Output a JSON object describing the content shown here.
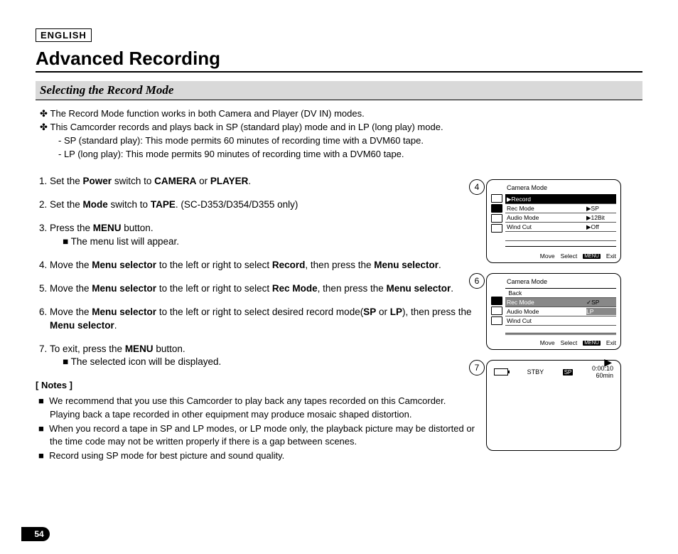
{
  "lang": "ENGLISH",
  "title": "Advanced Recording",
  "section": "Selecting the Record Mode",
  "bullet": "✤",
  "intro": {
    "l1": "The Record Mode function works in both Camera and Player (DV IN) modes.",
    "l2": "This Camcorder records and plays back in SP (standard play) mode and in LP (long play) mode.",
    "l3": "- SP (standard play): This mode permits 60 minutes of recording time with a DVM60 tape.",
    "l4": "- LP (long play): This mode permits 90 minutes of recording time with a DVM60 tape."
  },
  "steps": {
    "s1a": "Set the ",
    "s1b": "Power",
    "s1c": " switch to ",
    "s1d": "CAMERA",
    "s1e": " or ",
    "s1f": "PLAYER",
    "s1g": ".",
    "s2a": "Set the ",
    "s2b": "Mode",
    "s2c": " switch to ",
    "s2d": "TAPE",
    "s2e": ". (SC-D353/D354/D355 only)",
    "s3a": "Press the ",
    "s3b": "MENU",
    "s3c": " button.",
    "s3sub": "The menu list will appear.",
    "s4a": "Move the ",
    "s4b": "Menu selector",
    "s4c": " to the left or right to select ",
    "s4d": "Record",
    "s4e": ", then press the ",
    "s4f": "Menu selector",
    "s4g": ".",
    "s5a": "Move the ",
    "s5b": "Menu selector",
    "s5c": " to the left or right to select ",
    "s5d": "Rec Mode",
    "s5e": ", then press the ",
    "s5f": "Menu selector",
    "s5g": ".",
    "s6a": "Move the ",
    "s6b": "Menu selector",
    "s6c": " to the left or right to select desired record mode(",
    "s6d": "SP",
    "s6e": " or ",
    "s6f": "LP",
    "s6g": "), then press the ",
    "s6h": "Menu selector",
    "s6i": ".",
    "s7a": "To exit, press the ",
    "s7b": "MENU",
    "s7c": " button.",
    "s7sub": "The selected icon will be displayed."
  },
  "notes_title": "[ Notes ]",
  "notes": {
    "n1": "We recommend that you use this Camcorder to play back any tapes recorded on this Camcorder. Playing back a tape recorded in other equipment may produce mosaic shaped distortion.",
    "n2": "When you record a tape in SP and LP modes, or LP mode only, the playback picture may be distorted or the time code may not be written properly if there is a gap between scenes.",
    "n3": "Record using SP mode for best picture and sound quality."
  },
  "fig4": {
    "num": "4",
    "mode": "Camera Mode",
    "record": "Record",
    "rec_mode": "Rec Mode",
    "rec_val": "SP",
    "audio_mode": "Audio Mode",
    "audio_val": "12Bit",
    "wind": "Wind Cut",
    "wind_val": "Off",
    "move": "Move",
    "select": "Select",
    "menu": "MENU",
    "exit": "Exit"
  },
  "fig6": {
    "num": "6",
    "mode": "Camera Mode",
    "back": "Back",
    "rec_mode": "Rec Mode",
    "sp": "SP",
    "audio_mode": "Audio Mode",
    "lp": "LP",
    "wind": "Wind Cut",
    "move": "Move",
    "select": "Select",
    "menu": "MENU",
    "exit": "Exit"
  },
  "fig7": {
    "num": "7",
    "stby": "STBY",
    "sp": "SP",
    "time": "0:00:10",
    "remain": "60min"
  },
  "pagenum": "54"
}
